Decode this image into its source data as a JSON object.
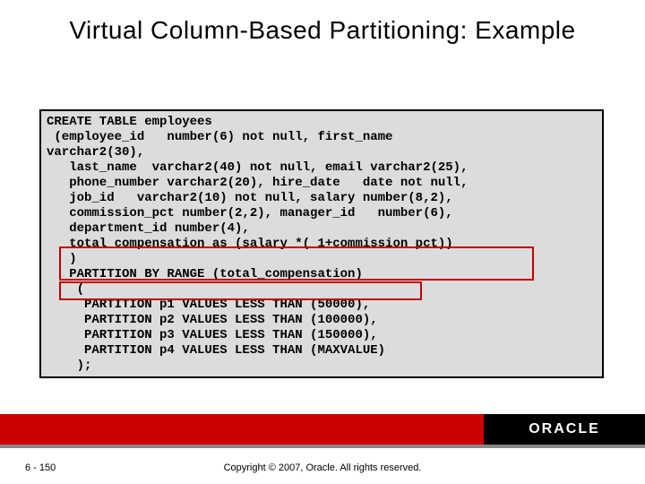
{
  "title": "Virtual Column-Based Partitioning: Example",
  "code": {
    "l0": "CREATE TABLE employees",
    "l1": " (employee_id   number(6) not null, first_name",
    "l2": "varchar2(30),",
    "l3": "   last_name  varchar2(40) not null, email varchar2(25),",
    "l4": "   phone_number varchar2(20), hire_date   date not null,",
    "l5": "   job_id   varchar2(10) not null, salary number(8,2),",
    "l6": "   commission_pct number(2,2), manager_id   number(6),",
    "l7": "   department_id number(4),",
    "l8": "   total_compensation as (salary *( 1+commission_pct))",
    "l9": "   )",
    "l10": "   PARTITION BY RANGE (total_compensation)",
    "l11": "    (",
    "l12": "     PARTITION p1 VALUES LESS THAN (50000),",
    "l13": "     PARTITION p2 VALUES LESS THAN (100000),",
    "l14": "     PARTITION p3 VALUES LESS THAN (150000),",
    "l15": "     PARTITION p4 VALUES LESS THAN (MAXVALUE)",
    "l16": "    );"
  },
  "logo_text": "ORACLE",
  "page_number": "6 - 150",
  "copyright": "Copyright © 2007, Oracle. All rights reserved."
}
